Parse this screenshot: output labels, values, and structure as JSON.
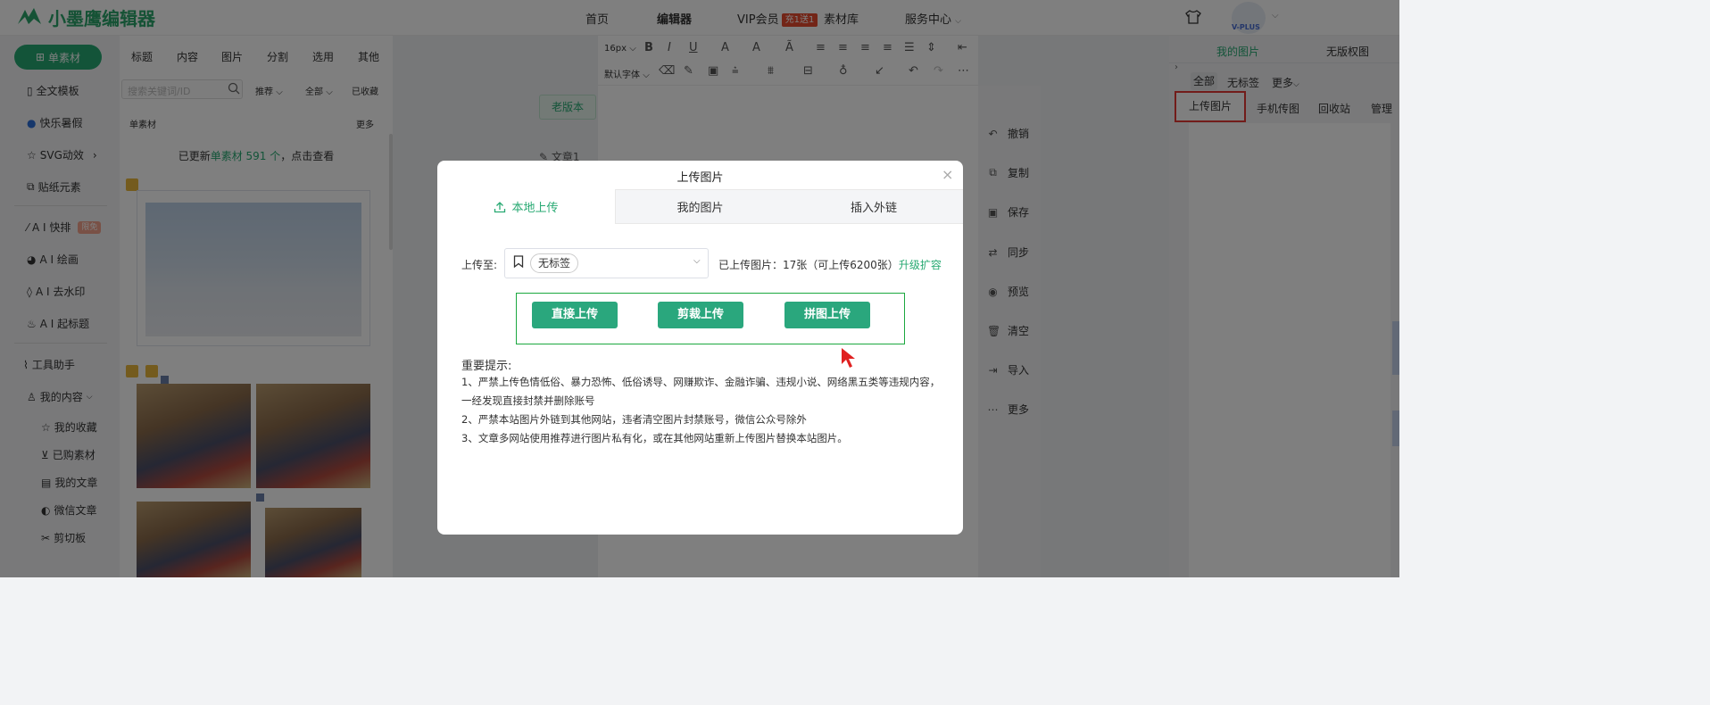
{
  "header": {
    "logo_text": "小墨鹰编辑器",
    "nav": [
      "首页",
      "编辑器",
      "VIP会员",
      "素材库",
      "服务中心"
    ],
    "vip_badge": "充1送1",
    "avatar_badge": "V-PLUS"
  },
  "sidebar": {
    "primary_button": "单素材",
    "items": [
      "全文模板",
      "快乐暑假",
      "SVG动效",
      "贴纸元素",
      "A I 快排",
      "A I 绘画",
      "A I 去水印",
      "A I 起标题",
      "工具助手",
      "我的内容"
    ],
    "ai_badge": "限免",
    "sub_items": [
      "我的收藏",
      "已购素材",
      "我的文章",
      "微信文章",
      "剪切板"
    ]
  },
  "material_panel": {
    "tabs": [
      "标题",
      "内容",
      "图片",
      "分割",
      "选用",
      "其他"
    ],
    "search_placeholder": "搜索关键词/ID",
    "filters": [
      "推荐",
      "全部",
      "已收藏"
    ],
    "section_title": "单素材",
    "section_more": "更多",
    "updated_prefix": "已更新",
    "updated_highlight": "单素材 591 个",
    "updated_suffix": "，点击查看"
  },
  "editor": {
    "font_size": "16px",
    "default_font": "默认字体",
    "old_version": "老版本",
    "article_chip": "文章1"
  },
  "actions": [
    "撤销",
    "复制",
    "保存",
    "同步",
    "预览",
    "清空",
    "导入",
    "更多"
  ],
  "image_panel": {
    "tabs": [
      "我的图片",
      "无版权图"
    ],
    "filters": [
      "全部",
      "无标签",
      "更多"
    ],
    "actions": [
      "上传图片",
      "手机传图",
      "回收站",
      "管理"
    ]
  },
  "modal": {
    "title": "上传图片",
    "tabs": [
      "本地上传",
      "我的图片",
      "插入外链"
    ],
    "upload_to_label": "上传至:",
    "selected_tag": "无标签",
    "uploaded_info": "已上传图片：17张（可上传6200张）",
    "upgrade_link": "升级扩容",
    "buttons": [
      "直接上传",
      "剪裁上传",
      "拼图上传"
    ],
    "notice_title": "重要提示:",
    "notices": [
      "1、严禁上传色情低俗、暴力恐怖、低俗诱导、网赚欺诈、金融诈骗、违规小说、网络黑五类等违规内容，一经发现直接封禁并删除账号",
      "2、严禁本站图片外链到其他网站，违者清空图片封禁账号，微信公众号除外",
      "3、文章多网站使用推荐进行图片私有化，或在其他网站重新上传图片替换本站图片。"
    ]
  },
  "colors": {
    "brand_green": "#27a972",
    "highlight_red": "#e53935",
    "button_frame_green": "#1ba83f"
  }
}
